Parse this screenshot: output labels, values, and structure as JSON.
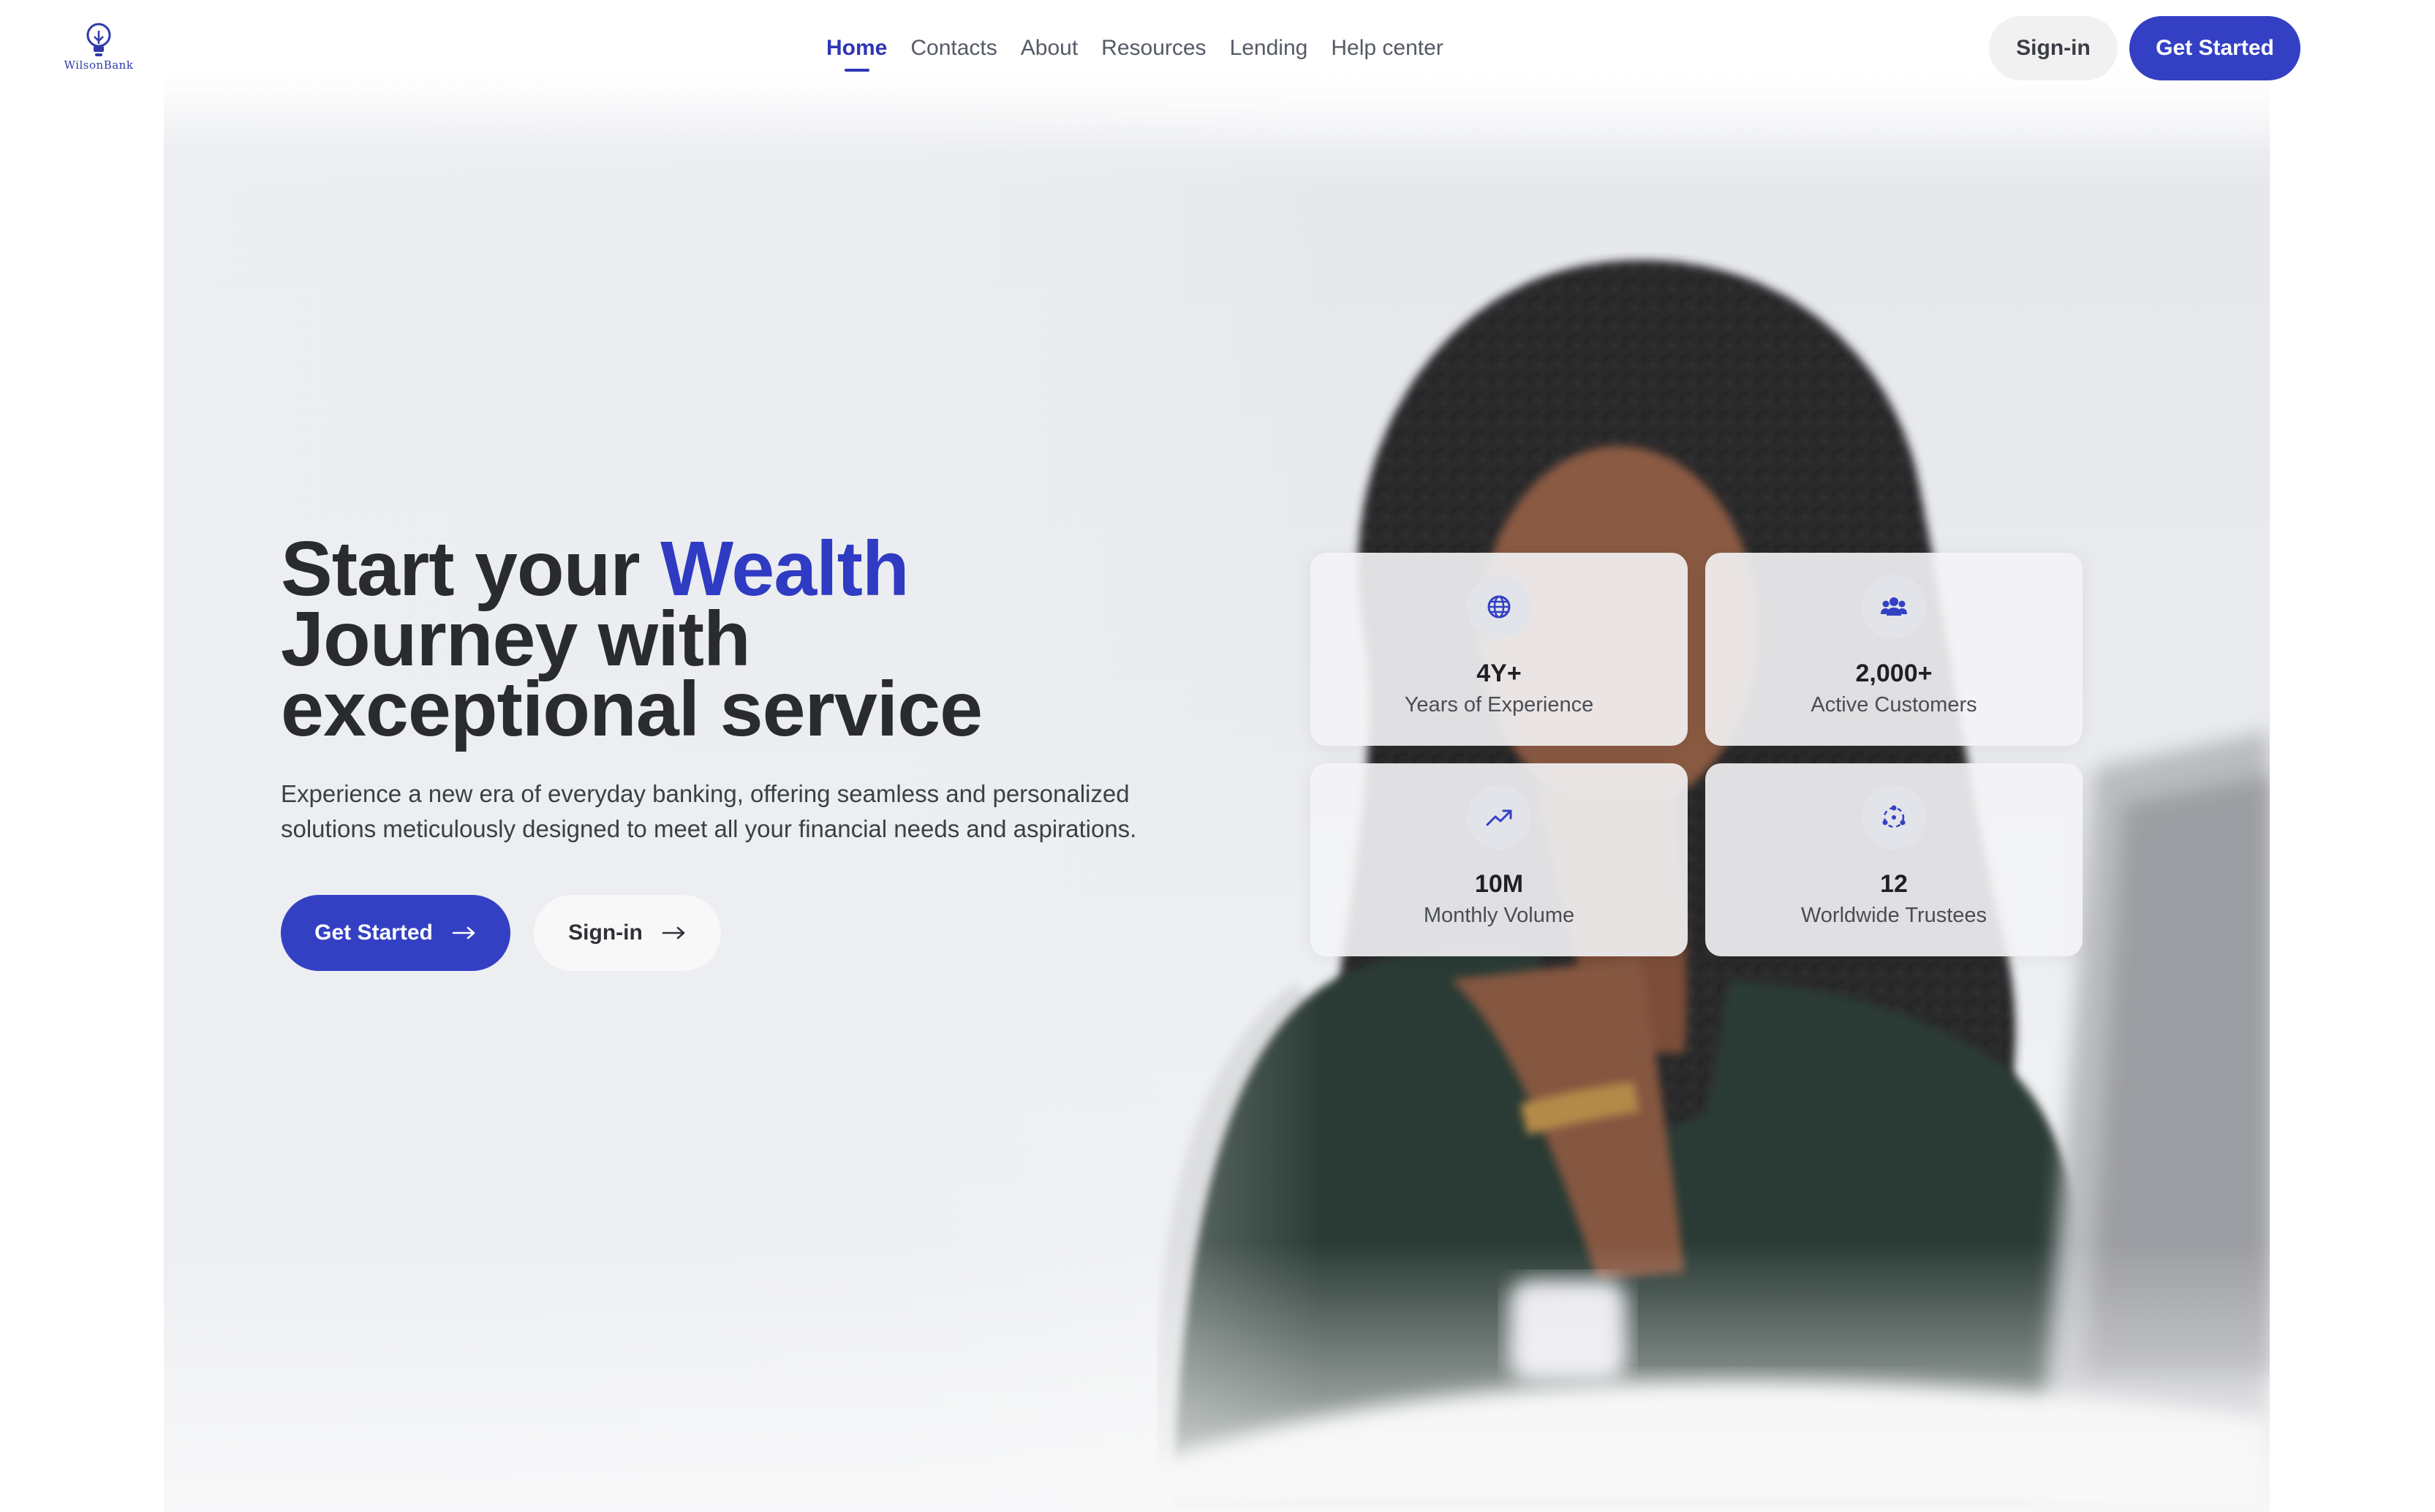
{
  "brand": {
    "logo_text": "WilsonBank"
  },
  "nav": {
    "items": [
      {
        "label": "Home",
        "active": true
      },
      {
        "label": "Contacts",
        "active": false
      },
      {
        "label": "About",
        "active": false
      },
      {
        "label": "Resources",
        "active": false
      },
      {
        "label": "Lending",
        "active": false
      },
      {
        "label": "Help center",
        "active": false
      }
    ]
  },
  "header_actions": {
    "signin_label": "Sign-in",
    "get_started_label": "Get Started"
  },
  "hero": {
    "headline_part1": "Start your ",
    "headline_accent": "Wealth",
    "headline_part2": "Journey with",
    "headline_part3": "exceptional service",
    "subtext": "Experience a new era of everyday banking, offering seamless and personalized solutions meticulously designed to meet all your financial needs and aspirations.",
    "primary_button": "Get Started",
    "secondary_button": "Sign-in"
  },
  "stats": [
    {
      "icon": "globe-icon",
      "value": "4Y+",
      "label": "Years of Experience"
    },
    {
      "icon": "users-icon",
      "value": "2,000+",
      "label": "Active Customers"
    },
    {
      "icon": "trending-up-icon",
      "value": "10M",
      "label": "Monthly Volume"
    },
    {
      "icon": "network-icon",
      "value": "12",
      "label": "Worldwide Trustees"
    }
  ],
  "colors": {
    "accent": "#3340c4",
    "text_dark": "#2a2b30",
    "muted": "#555a66"
  }
}
